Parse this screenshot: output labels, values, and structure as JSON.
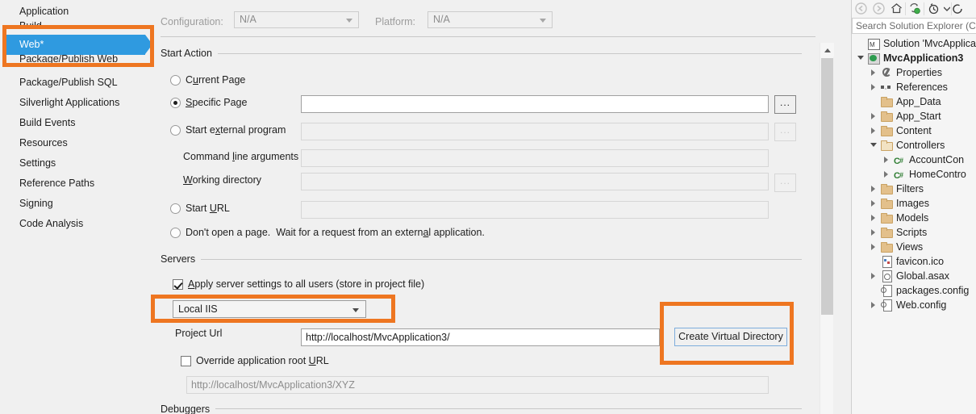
{
  "left_nav": {
    "items": [
      {
        "label": "Application",
        "state": "normal"
      },
      {
        "label": "Build",
        "state": "clipped"
      },
      {
        "label": "Web*",
        "state": "selected"
      },
      {
        "label": "Package/Publish Web",
        "state": "clipped"
      },
      {
        "label": "Package/Publish SQL",
        "state": "normal"
      },
      {
        "label": "Silverlight Applications",
        "state": "normal"
      },
      {
        "label": "Build Events",
        "state": "normal"
      },
      {
        "label": "Resources",
        "state": "normal"
      },
      {
        "label": "Settings",
        "state": "normal"
      },
      {
        "label": "Reference Paths",
        "state": "normal"
      },
      {
        "label": "Signing",
        "state": "normal"
      },
      {
        "label": "Code Analysis",
        "state": "normal"
      }
    ]
  },
  "callouts": {
    "color": "#ee7621",
    "web_tab": "Web*",
    "server_dropdown": "Local IIS",
    "create_virtual_directory": "Create Virtual Directory"
  },
  "toolbar": {
    "configuration_label": "Configuration:",
    "configuration_value": "N/A",
    "platform_label": "Platform:",
    "platform_value": "N/A"
  },
  "start_action": {
    "group_label": "Start Action",
    "options": [
      {
        "label": "Current Page",
        "accel": "r",
        "selected": false
      },
      {
        "label": "Specific Page",
        "accel": "S",
        "selected": true
      },
      {
        "label": "Start external program",
        "accel": "x",
        "selected": false
      },
      {
        "label": "Start URL",
        "accel": "U",
        "selected": false
      },
      {
        "label": "Don't open a page.  Wait for a request from an external application.",
        "accel": "a",
        "selected": false
      }
    ],
    "specific_page_value": "",
    "external_program_value": "",
    "command_line_label": "Command line arguments",
    "command_line_value": "",
    "working_directory_label": "Working directory",
    "working_directory_value": "",
    "start_url_value": "",
    "browse_button": "..."
  },
  "servers": {
    "group_label": "Servers",
    "apply_all_users_label": "Apply server settings to all users (store in project file)",
    "apply_all_users_checked": true,
    "server_type": "Local IIS",
    "project_url_label": "Project Url",
    "project_url_value": "http://localhost/MvcApplication3/",
    "create_virtual_directory_button": "Create Virtual Directory",
    "override_root_label": "Override application root URL",
    "override_root_checked": false,
    "override_root_value": "http://localhost/MvcApplication3/XYZ"
  },
  "debuggers": {
    "group_label": "Debuggers"
  },
  "solution_explorer": {
    "search_placeholder": "Search Solution Explorer (Ctr",
    "toolbar_icons": [
      "back-arrow-icon",
      "forward-arrow-icon",
      "home-icon",
      "sync-with-active-document-icon",
      "pending-changes-icon",
      "chevron-down-icon"
    ],
    "tree": [
      {
        "label": "Solution 'MvcApplicati",
        "indent": 0,
        "icon": "solution-icon",
        "expander": "none",
        "bold": false
      },
      {
        "label": "MvcApplication3",
        "indent": 0,
        "icon": "project-icon",
        "expander": "open",
        "bold": true
      },
      {
        "label": "Properties",
        "indent": 1,
        "icon": "wrench-icon",
        "expander": "closed",
        "bold": false
      },
      {
        "label": "References",
        "indent": 1,
        "icon": "references-icon",
        "expander": "closed",
        "bold": false
      },
      {
        "label": "App_Data",
        "indent": 1,
        "icon": "folder-icon",
        "expander": "none",
        "bold": false
      },
      {
        "label": "App_Start",
        "indent": 1,
        "icon": "folder-icon",
        "expander": "closed",
        "bold": false
      },
      {
        "label": "Content",
        "indent": 1,
        "icon": "folder-icon",
        "expander": "closed",
        "bold": false
      },
      {
        "label": "Controllers",
        "indent": 1,
        "icon": "folder-open-icon",
        "expander": "open",
        "bold": false
      },
      {
        "label": "AccountCon",
        "indent": 2,
        "icon": "csharp-file-icon",
        "expander": "closed",
        "bold": false
      },
      {
        "label": "HomeContro",
        "indent": 2,
        "icon": "csharp-file-icon",
        "expander": "closed",
        "bold": false
      },
      {
        "label": "Filters",
        "indent": 1,
        "icon": "folder-icon",
        "expander": "closed",
        "bold": false
      },
      {
        "label": "Images",
        "indent": 1,
        "icon": "folder-icon",
        "expander": "closed",
        "bold": false
      },
      {
        "label": "Models",
        "indent": 1,
        "icon": "folder-icon",
        "expander": "closed",
        "bold": false
      },
      {
        "label": "Scripts",
        "indent": 1,
        "icon": "folder-icon",
        "expander": "closed",
        "bold": false
      },
      {
        "label": "Views",
        "indent": 1,
        "icon": "folder-icon",
        "expander": "closed",
        "bold": false
      },
      {
        "label": "favicon.ico",
        "indent": 1,
        "icon": "ico-file-icon",
        "expander": "none",
        "bold": false
      },
      {
        "label": "Global.asax",
        "indent": 1,
        "icon": "asax-file-icon",
        "expander": "closed",
        "bold": false
      },
      {
        "label": "packages.config",
        "indent": 1,
        "icon": "config-file-icon",
        "expander": "none",
        "bold": false
      },
      {
        "label": "Web.config",
        "indent": 1,
        "icon": "config-file-icon",
        "expander": "closed",
        "bold": false
      }
    ]
  }
}
